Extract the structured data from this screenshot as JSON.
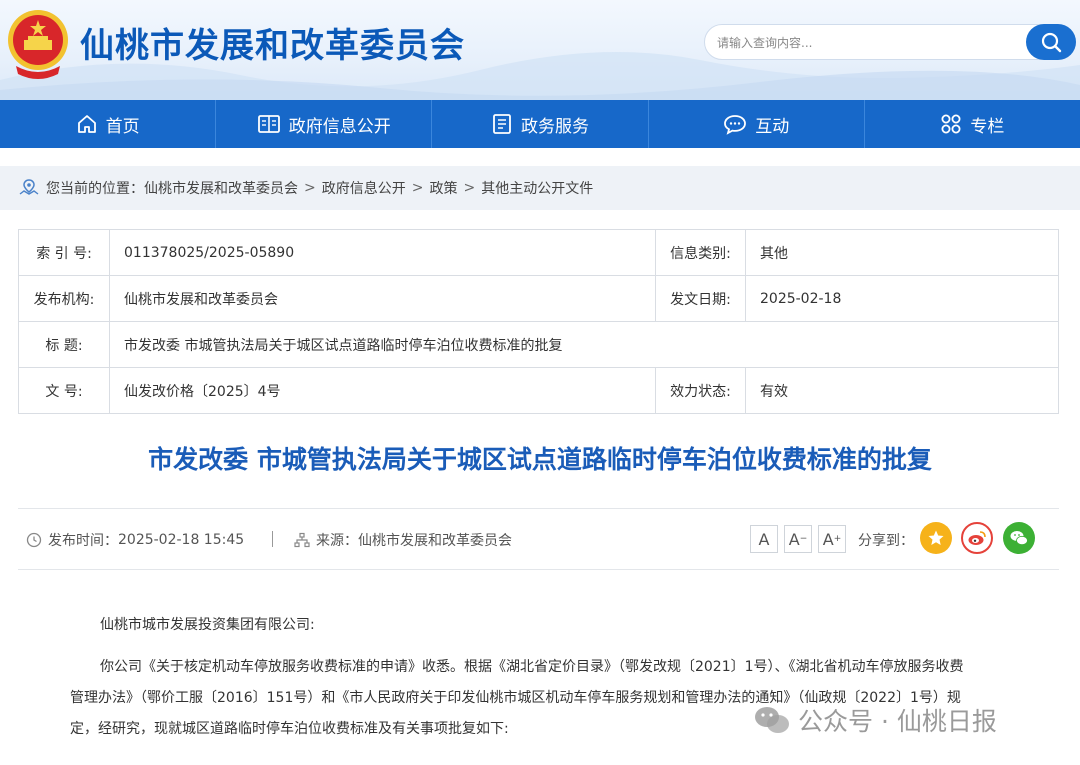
{
  "header": {
    "site_title": "仙桃市发展和改革委员会",
    "search_placeholder": "请输入查询内容..."
  },
  "nav": [
    {
      "label": "首页"
    },
    {
      "label": "政府信息公开"
    },
    {
      "label": "政务服务"
    },
    {
      "label": "互动"
    },
    {
      "label": "专栏"
    }
  ],
  "breadcrumb": {
    "prefix": "您当前的位置：",
    "items": [
      "仙桃市发展和改革委员会",
      "政府信息公开",
      "政策",
      "其他主动公开文件"
    ]
  },
  "info": {
    "index_label": "索 引 号:",
    "index_value": "011378025/2025-05890",
    "category_label": "信息类别:",
    "category_value": "其他",
    "issuer_label": "发布机构:",
    "issuer_value": "仙桃市发展和改革委员会",
    "date_label": "发文日期:",
    "date_value": "2025-02-18",
    "title_label": "标 题:",
    "title_value": "市发改委 市城管执法局关于城区试点道路临时停车泊位收费标准的批复",
    "docno_label": "文 号:",
    "docno_value": "仙发改价格〔2025〕4号",
    "validity_label": "效力状态:",
    "validity_value": "有效"
  },
  "article": {
    "title": "市发改委 市城管执法局关于城区试点道路临时停车泊位收费标准的批复",
    "publish_label": "发布时间：",
    "publish_time": "2025-02-18 15:45",
    "source_label": "来源：",
    "source_value": "仙桃市发展和改革委员会",
    "font_large": "A",
    "font_medium": "A",
    "font_small": "A",
    "share_label": "分享到：",
    "recipient": "仙桃市城市发展投资集团有限公司:",
    "para1_line1": "你公司《关于核定机动车停放服务收费标准的申请》收悉。根据《湖北省定价目录》（鄂发改规〔2021〕1号）、《湖北省机动车停放服务收费",
    "para1_line2": "管理办法》（鄂价工服〔2016〕151号）和《市人民政府关于印发仙桃市城区机动车停车服务规划和管理办法的通知》（仙政规〔2022〕1号）规",
    "para1_line3": "定，经研究，现就城区道路临时停车泊位收费标准及有关事项批复如下:"
  },
  "watermark": "公众号 · 仙桃日报",
  "colors": {
    "brand_blue": "#1768c9",
    "title_blue": "#1a5cb8",
    "share_yellow": "#f6b21a",
    "weibo_red": "#e5423a",
    "wechat_green": "#3cb034"
  }
}
